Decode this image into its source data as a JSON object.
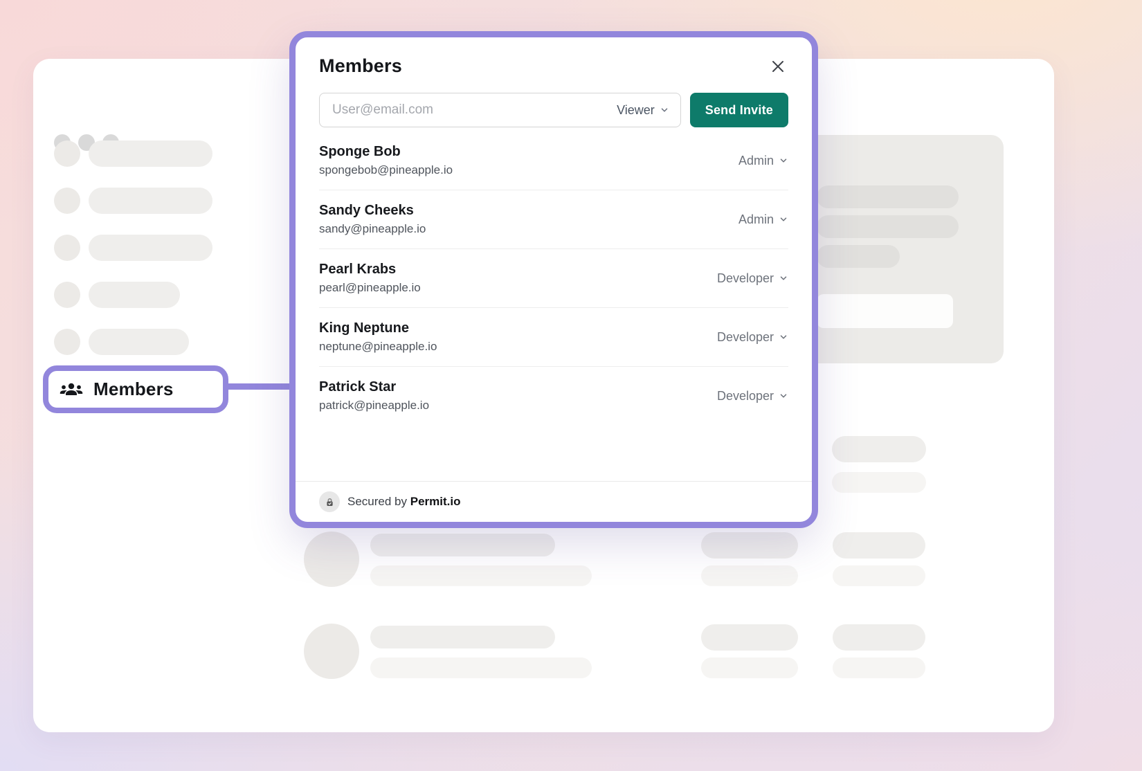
{
  "modal": {
    "title": "Members",
    "invite": {
      "placeholder": "User@email.com",
      "role_selector": "Viewer",
      "send_button": "Send Invite"
    },
    "members": [
      {
        "name": "Sponge Bob",
        "email": "spongebob@pineapple.io",
        "role": "Admin"
      },
      {
        "name": "Sandy Cheeks",
        "email": "sandy@pineapple.io",
        "role": "Admin"
      },
      {
        "name": "Pearl Krabs",
        "email": "pearl@pineapple.io",
        "role": "Developer"
      },
      {
        "name": "King Neptune",
        "email": "neptune@pineapple.io",
        "role": "Developer"
      },
      {
        "name": "Patrick Star",
        "email": "patrick@pineapple.io",
        "role": "Developer"
      }
    ],
    "footer": {
      "secured_by": "Secured by",
      "brand": "Permit.io"
    }
  },
  "sidebar": {
    "members_label": "Members"
  },
  "colors": {
    "accent_purple": "#9286dc",
    "teal": "#0e7b6a"
  }
}
